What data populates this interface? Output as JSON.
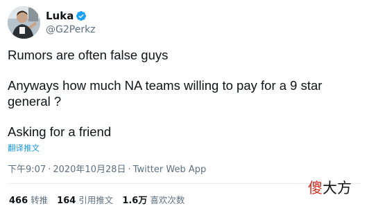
{
  "user": {
    "display_name": "Luka",
    "handle": "@G2Perkz",
    "verified": true
  },
  "tweet": {
    "paragraphs": [
      "Rumors are often false guys",
      "Anyways how much NA teams willing to pay for a 9 star general ?",
      "Asking for a friend"
    ],
    "translate_label": "翻译推文",
    "time": "下午9:07",
    "date": "2020年10月28日",
    "separator": "·",
    "source_app": "Twitter Web App"
  },
  "stats": {
    "retweets_count": "466",
    "retweets_label": "转推",
    "quotes_count": "164",
    "quotes_label": "引用推文",
    "likes_count": "1.6万",
    "likes_label": "喜欢次数"
  },
  "watermark": {
    "char1": "傻",
    "char2": "大",
    "char3": "方"
  },
  "colors": {
    "link_blue": "#1b95e0",
    "verified_blue": "#1da1f2",
    "secondary_text": "#5b7083",
    "primary_text": "#0f1419",
    "watermark_red": "#d62a1e"
  }
}
